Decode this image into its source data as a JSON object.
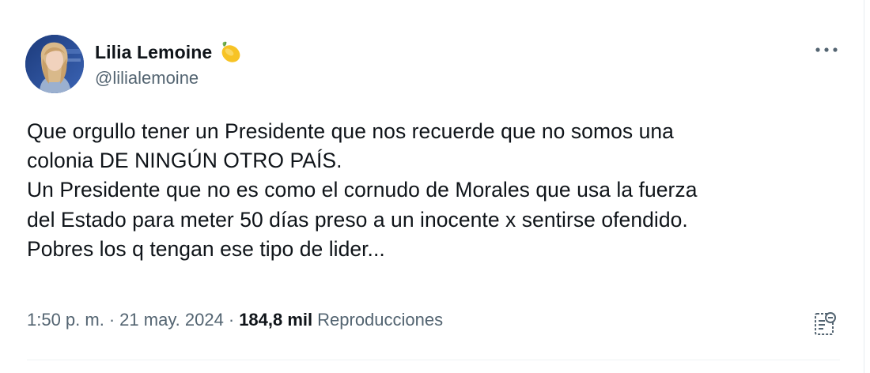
{
  "author": {
    "display_name": "Lilia Lemoine",
    "handle": "@lilialemoine",
    "emoji": "lemon-icon"
  },
  "tweet": {
    "lines": [
      "Que orgullo tener un Presidente que nos recuerde que no somos una",
      "colonia DE NINGÚN OTRO PAÍS.",
      "Un Presidente que no es como el cornudo de Morales que usa la fuerza",
      "del Estado para meter 50 días preso a un inocente x sentirse ofendido.",
      "Pobres los q tengan ese tipo de lider..."
    ]
  },
  "meta": {
    "time": "1:50 p. m.",
    "separator": "·",
    "date": "21 may. 2024",
    "views_count": "184,8 mil",
    "views_label": "Reproducciones"
  },
  "icons": {
    "more": "more-icon",
    "analytics": "analytics-icon"
  },
  "colors": {
    "text_primary": "#0f1419",
    "text_secondary": "#536471",
    "divider": "#eff3f4"
  }
}
